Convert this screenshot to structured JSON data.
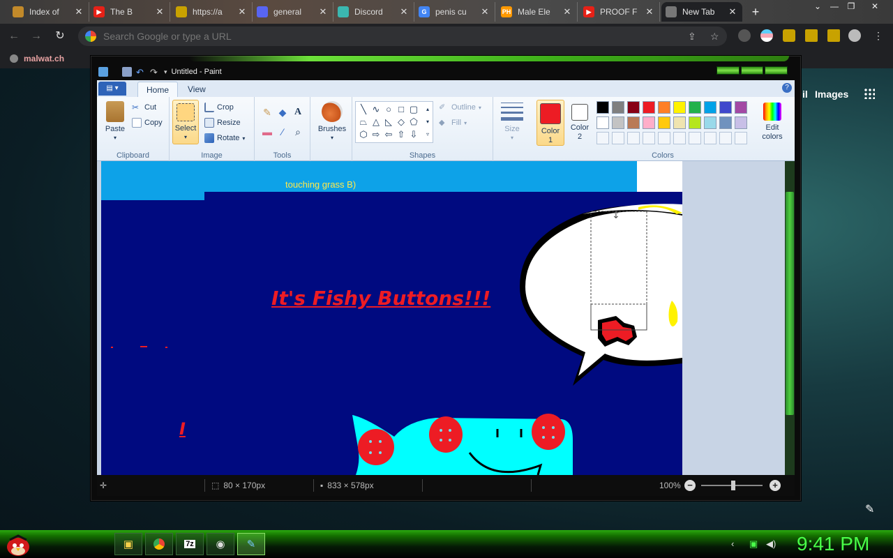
{
  "browser": {
    "tabs": [
      {
        "title": "Index of",
        "fav_color": "#c28a2a",
        "fav_text": ""
      },
      {
        "title": "The B",
        "fav_color": "#e62117",
        "fav_text": "▶"
      },
      {
        "title": "https://a",
        "fav_color": "#c9a200",
        "fav_text": ""
      },
      {
        "title": "general",
        "fav_color": "#5865f2",
        "fav_text": ""
      },
      {
        "title": "Discord",
        "fav_color": "#3bb7b0",
        "fav_text": ""
      },
      {
        "title": "penis cu",
        "fav_color": "#4285f4",
        "fav_text": "G"
      },
      {
        "title": "Male Ele",
        "fav_color": "#f90",
        "fav_text": "PH"
      },
      {
        "title": "PROOF F",
        "fav_color": "#e62117",
        "fav_text": "▶"
      },
      {
        "title": "New Tab",
        "fav_color": "#777",
        "fav_text": ""
      }
    ],
    "omnibox_placeholder": "Search Google or type a URL",
    "bookmark": "malwat.ch",
    "ntp_links": {
      "gmail_partial": "il",
      "images": "Images"
    }
  },
  "paint": {
    "window_title": "Untitled - Paint",
    "ribbon_tabs": [
      "Home",
      "View"
    ],
    "groups": {
      "clipboard": {
        "label": "Clipboard",
        "paste": "Paste",
        "cut": "Cut",
        "copy": "Copy"
      },
      "image": {
        "label": "Image",
        "select": "Select",
        "crop": "Crop",
        "resize": "Resize",
        "rotate": "Rotate"
      },
      "tools": {
        "label": "Tools"
      },
      "brushes": {
        "label": "Brushes"
      },
      "shapes": {
        "label": "Shapes",
        "outline": "Outline",
        "fill": "Fill"
      },
      "size": {
        "label": "Size"
      },
      "colors": {
        "label": "Colors",
        "color1": "Color 1",
        "color2": "Color 2",
        "edit": "Edit colors"
      }
    },
    "palette_row1": [
      "#000000",
      "#7f7f7f",
      "#880015",
      "#ed1c24",
      "#ff7f27",
      "#fff200",
      "#22b14c",
      "#00a2e8",
      "#3f48cc",
      "#a349a4"
    ],
    "palette_row2": [
      "#ffffff",
      "#c3c3c3",
      "#b97a57",
      "#ffaec9",
      "#ffc90e",
      "#efe4b0",
      "#b5e61d",
      "#99d9ea",
      "#7092be",
      "#c8bfe7"
    ],
    "color1": "#ed1c24",
    "color2": "#ffffff",
    "canvas": {
      "top_text": "touching grass B)",
      "headline": "It's Fishy Buttons!!!",
      "letter": "I"
    },
    "status": {
      "selection": "80 × 170px",
      "size": "833 × 578px",
      "zoom": "100%"
    }
  },
  "taskbar": {
    "clock": "9:41 PM"
  }
}
